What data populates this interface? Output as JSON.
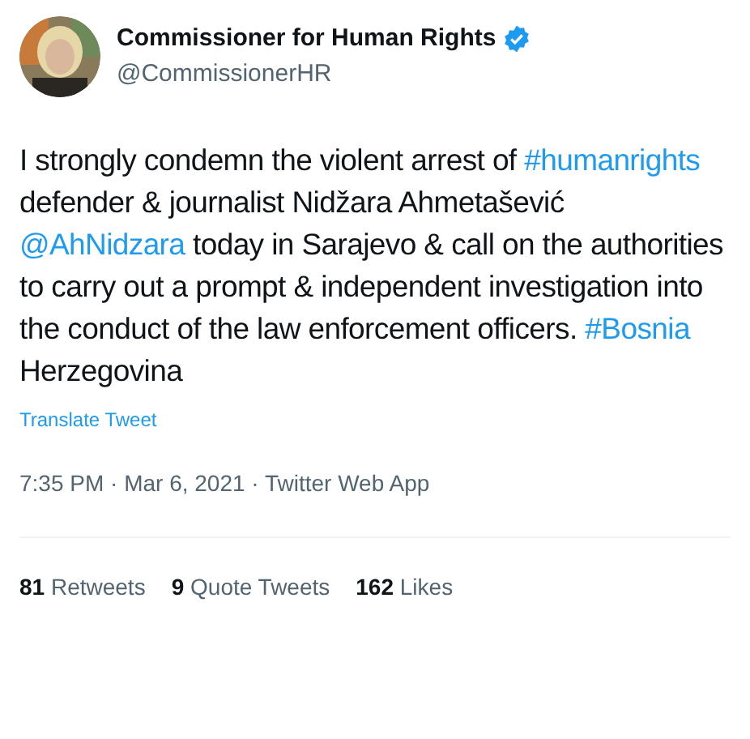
{
  "author": {
    "name": "Commissioner for Human Rights",
    "verified": true,
    "handle": "@CommissionerHR"
  },
  "tweet_text": [
    {
      "kind": "text",
      "text": "I strongly condemn the violent arrest of "
    },
    {
      "kind": "hashtag",
      "text": "#humanrights"
    },
    {
      "kind": "text",
      "text": " defender & journalist Nidžara Ahmetašević "
    },
    {
      "kind": "mention",
      "text": "@AhNidzara"
    },
    {
      "kind": "text",
      "text": " today in Sarajevo & call on the authorities to carry out a prompt & independent investigation into the conduct of the law enforcement officers. "
    },
    {
      "kind": "hashtag",
      "text": "#Bosnia"
    },
    {
      "kind": "text",
      "text": " Herzegovina"
    }
  ],
  "translate_link": "Translate Tweet",
  "meta": "7:35 PM · Mar 6, 2021 · Twitter Web App",
  "stats": [
    {
      "count": "81",
      "label": "Retweets"
    },
    {
      "count": "9",
      "label": "Quote Tweets"
    },
    {
      "count": "162",
      "label": "Likes"
    }
  ]
}
